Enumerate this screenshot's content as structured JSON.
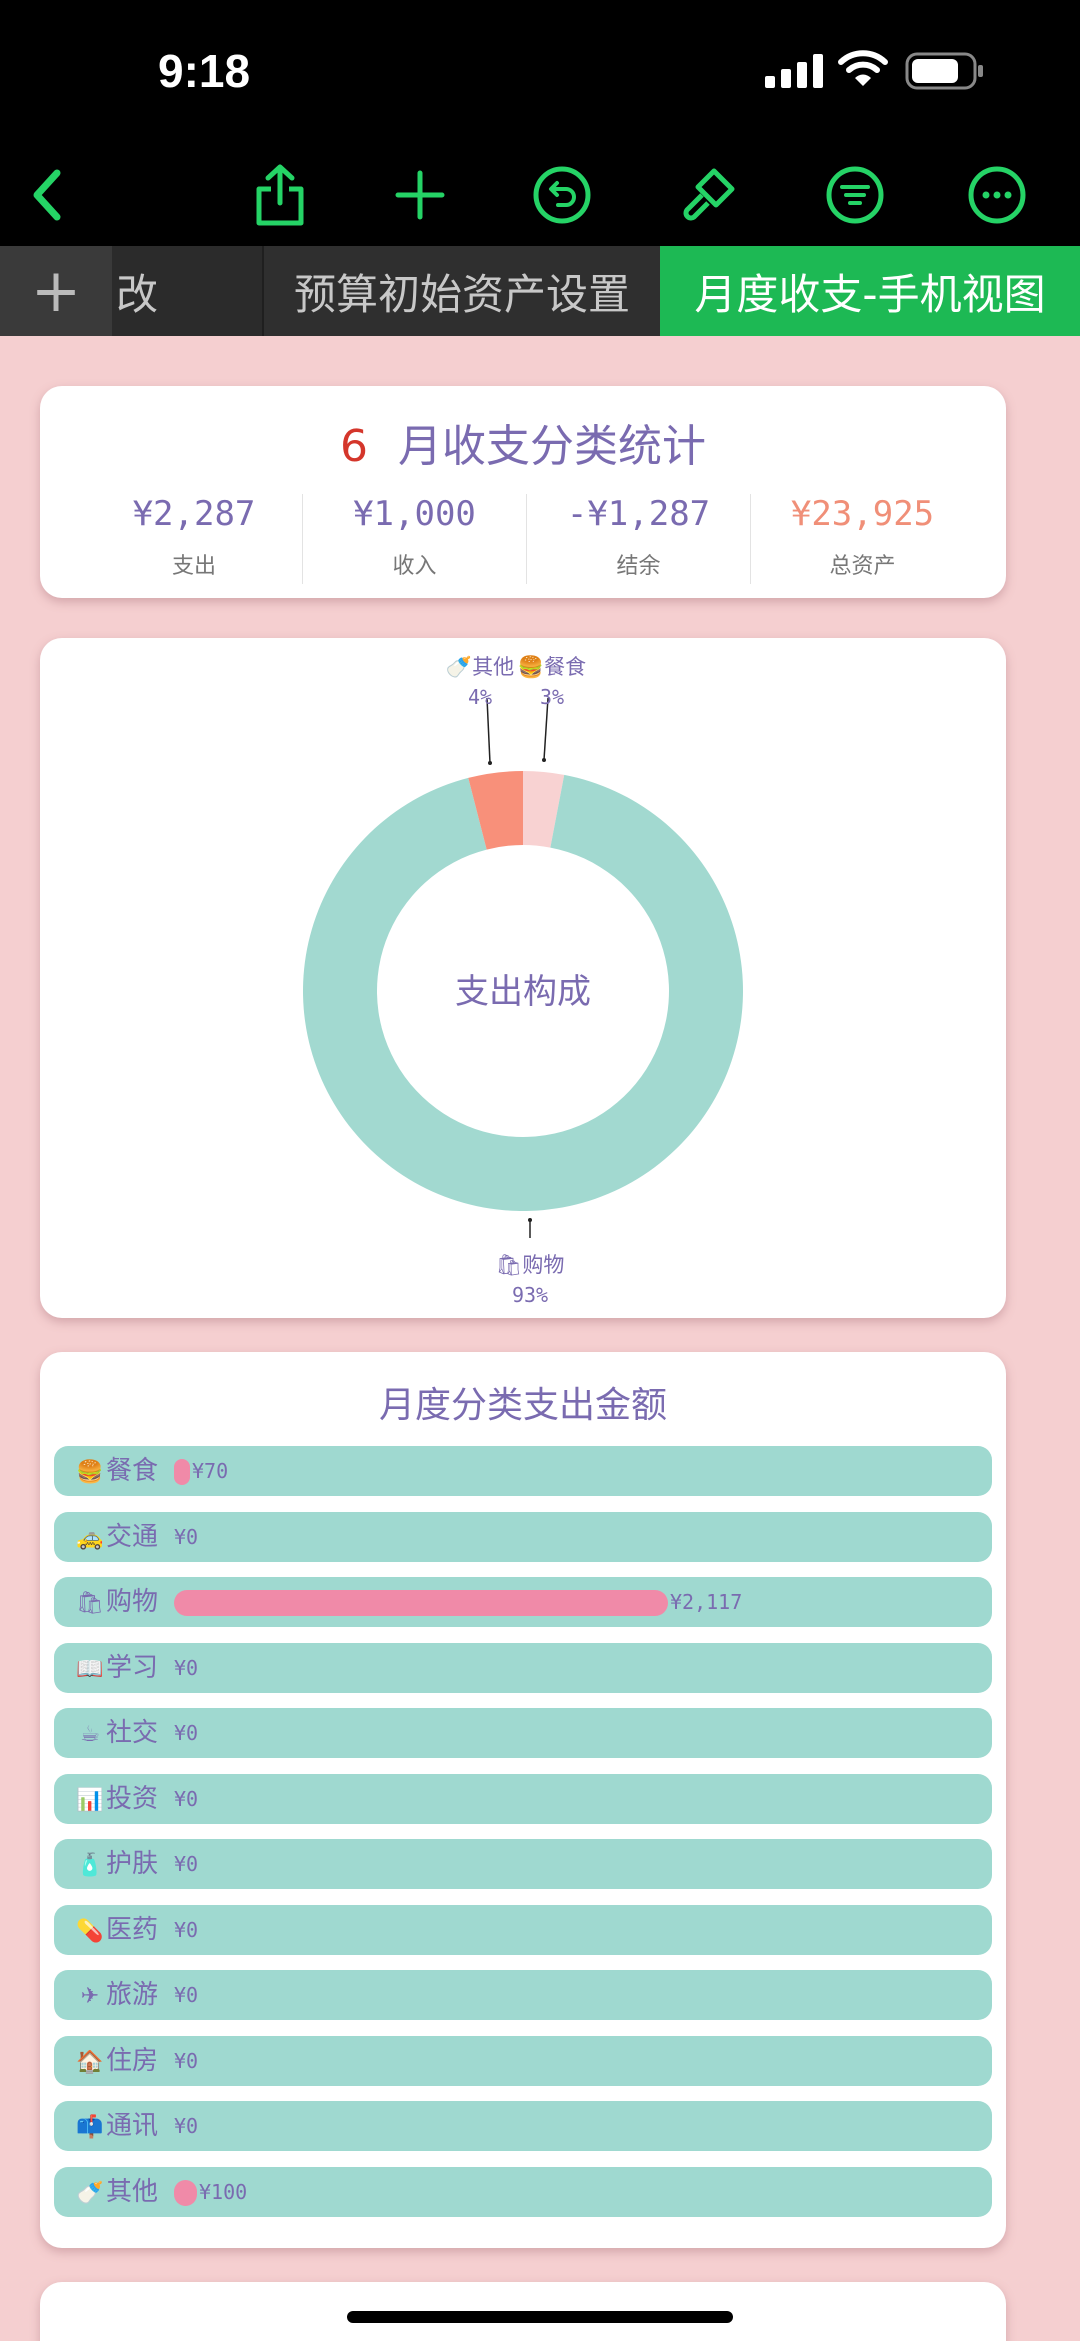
{
  "status_bar": {
    "time": "9:18"
  },
  "tabs": {
    "add": "+",
    "tab1": "改",
    "tab2": "预算初始资产设置",
    "tab3": "月度收支-手机视图"
  },
  "summary": {
    "month": "6",
    "title": "月收支分类统计",
    "stats": [
      {
        "value": "¥2,287",
        "label": "支出",
        "color": "#7a6bb0"
      },
      {
        "value": "¥1,000",
        "label": "收入",
        "color": "#7a6bb0"
      },
      {
        "value": "-¥1,287",
        "label": "结余",
        "color": "#7a6bb0"
      },
      {
        "value": "¥23,925",
        "label": "总资产",
        "color": "#f08f78"
      }
    ]
  },
  "donut": {
    "center_label": "支出构成",
    "slices": [
      {
        "name": "购物",
        "pct": 93,
        "label": "93%",
        "icon": "shopping-bag-icon",
        "color": "#a2d9d0"
      },
      {
        "name": "其他",
        "pct": 4,
        "label": "4%",
        "icon": "bottle-icon",
        "color": "#f8907a"
      },
      {
        "name": "餐食",
        "pct": 3,
        "label": "3%",
        "icon": "burger-icon",
        "color": "#f8d2d2"
      }
    ]
  },
  "category_chart": {
    "title": "月度分类支出金额",
    "max_value": 2117,
    "items": [
      {
        "icon": "burger-icon",
        "glyph": "🍔",
        "label": "餐食",
        "value": 70,
        "amount": "¥70"
      },
      {
        "icon": "taxi-icon",
        "glyph": "🚕",
        "label": "交通",
        "value": 0,
        "amount": "¥0"
      },
      {
        "icon": "shopping-bag-icon",
        "glyph": "🛍",
        "label": "购物",
        "value": 2117,
        "amount": "¥2,117"
      },
      {
        "icon": "book-icon",
        "glyph": "📖",
        "label": "学习",
        "value": 0,
        "amount": "¥0"
      },
      {
        "icon": "coffee-icon",
        "glyph": "☕",
        "label": "社交",
        "value": 0,
        "amount": "¥0"
      },
      {
        "icon": "bar-chart-icon",
        "glyph": "📊",
        "label": "投资",
        "value": 0,
        "amount": "¥0"
      },
      {
        "icon": "lotion-bottle-icon",
        "glyph": "🧴",
        "label": "护肤",
        "value": 0,
        "amount": "¥0"
      },
      {
        "icon": "pill-icon",
        "glyph": "💊",
        "label": "医药",
        "value": 0,
        "amount": "¥0"
      },
      {
        "icon": "airplane-icon",
        "glyph": "✈",
        "label": "旅游",
        "value": 0,
        "amount": "¥0"
      },
      {
        "icon": "house-icon",
        "glyph": "🏠",
        "label": "住房",
        "value": 0,
        "amount": "¥0"
      },
      {
        "icon": "mailbox-icon",
        "glyph": "📫",
        "label": "通讯",
        "value": 0,
        "amount": "¥0"
      },
      {
        "icon": "bottle-icon",
        "glyph": "🍼",
        "label": "其他",
        "value": 100,
        "amount": "¥100"
      }
    ]
  },
  "chart_data": [
    {
      "type": "pie",
      "title": "支出构成",
      "categories": [
        "购物",
        "其他",
        "餐食"
      ],
      "values": [
        93,
        4,
        3
      ],
      "unit": "%"
    },
    {
      "type": "bar",
      "title": "月度分类支出金额",
      "categories": [
        "餐食",
        "交通",
        "购物",
        "学习",
        "社交",
        "投资",
        "护肤",
        "医药",
        "旅游",
        "住房",
        "通讯",
        "其他"
      ],
      "values": [
        70,
        0,
        2117,
        0,
        0,
        0,
        0,
        0,
        0,
        0,
        0,
        100
      ]
    }
  ]
}
